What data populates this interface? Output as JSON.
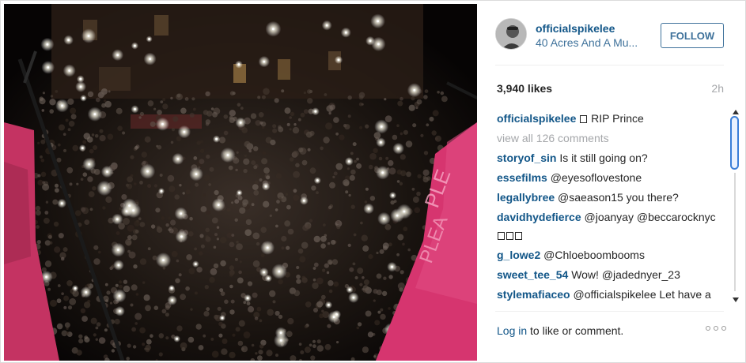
{
  "post": {
    "username": "officialspikelee",
    "location": "40 Acres And A Mu...",
    "follow_label": "FOLLOW",
    "likes": "3,940 likes",
    "time": "2h"
  },
  "caption": {
    "user": "officialspikelee",
    "text": "RIP Prince"
  },
  "view_all": "view all 126 comments",
  "comments": [
    {
      "user": "storyof_sin",
      "text": "Is it still going on?"
    },
    {
      "user": "essefilms",
      "text": "@eyesoflovestone"
    },
    {
      "user": "legallybree",
      "text": "@saeason15 you there?"
    },
    {
      "user": "davidhydefierce",
      "text": "@joanyay @beccarocknyc"
    },
    {
      "user": "g_lowe2",
      "text": "@Chloeboombooms"
    },
    {
      "user": "sweet_tee_54",
      "text": "Wow! @jadednyer_23"
    },
    {
      "user": "stylemafiaceo",
      "text": "@officialspikelee Let have a big party for his bday like you did for"
    }
  ],
  "footer": {
    "login_link": "Log in",
    "login_text": " to like or comment."
  },
  "icons": {
    "avatar": "profile-avatar",
    "more": "more-options-icon",
    "photo": "crowd-with-phone-lights"
  },
  "colors": {
    "link_blue": "#125688",
    "secondary_blue": "#3f729b",
    "banner_pink": "#d6356f"
  }
}
